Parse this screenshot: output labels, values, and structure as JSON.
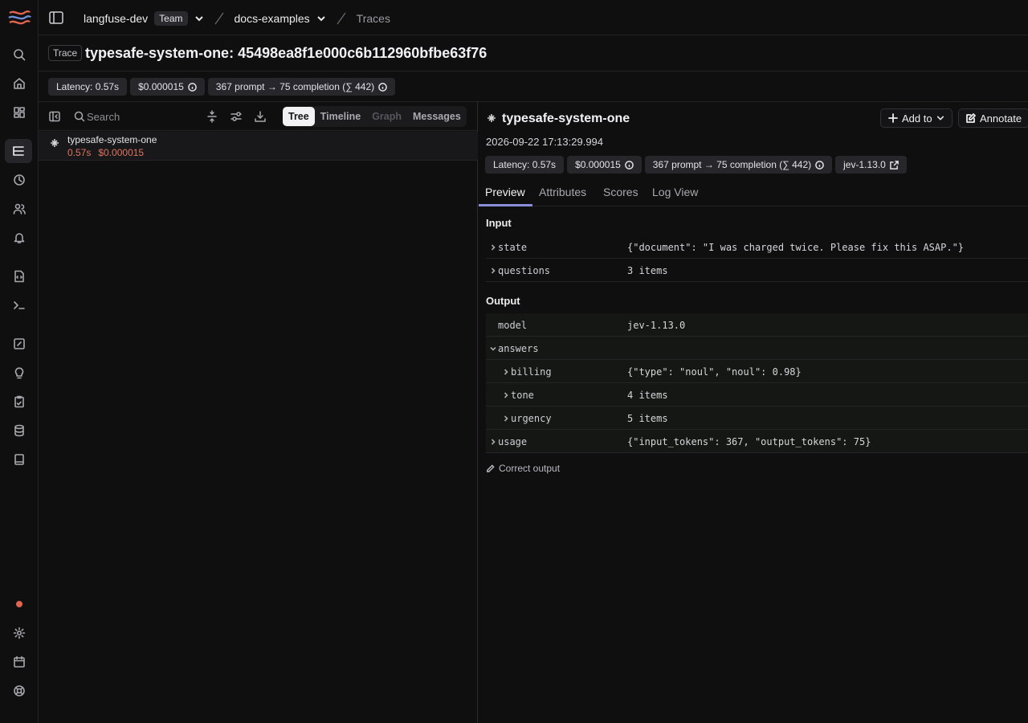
{
  "header": {
    "org": "langfuse-dev",
    "org_badge": "Team",
    "project": "docs-examples",
    "section": "Traces"
  },
  "trace": {
    "tag": "Trace",
    "title": "typesafe-system-one: 45498ea8f1e000c6b112960bfbe63f76",
    "badges": {
      "latency": "Latency: 0.57s",
      "cost": "$0.000015",
      "tokens": "367 prompt → 75 completion (∑ 442)"
    }
  },
  "left": {
    "search_placeholder": "Search",
    "view_tabs": [
      "Tree",
      "Timeline",
      "Graph",
      "Messages"
    ],
    "tree": [
      {
        "name": "typesafe-system-one",
        "latency": "0.57s",
        "cost": "$0.000015"
      }
    ]
  },
  "observation": {
    "name": "typesafe-system-one",
    "timestamp": "2026-09-22 17:13:29.994",
    "badges": {
      "latency": "Latency: 0.57s",
      "cost": "$0.000015",
      "tokens": "367 prompt → 75 completion (∑ 442)",
      "version": "jev-1.13.0"
    },
    "actions": {
      "add_to": "Add to",
      "annotate": "Annotate"
    },
    "tabs": [
      "Preview",
      "Attributes",
      "Scores",
      "Log View"
    ],
    "input_heading": "Input",
    "input": [
      {
        "key": "state",
        "value": "{\"document\": \"I was charged twice. Please fix this ASAP.\"}"
      },
      {
        "key": "questions",
        "value": "3 items"
      }
    ],
    "output_heading": "Output",
    "output": {
      "model_key": "model",
      "model_value": "jev-1.13.0",
      "answers_key": "answers",
      "billing_key": "billing",
      "billing_value": "{\"type\": \"noul\", \"noul\": 0.98}",
      "tone_key": "tone",
      "tone_value": "4 items",
      "urgency_key": "urgency",
      "urgency_value": "5 items",
      "usage_key": "usage",
      "usage_value": "{\"input_tokens\": 367, \"output_tokens\": 75}"
    },
    "correct_output": "Correct output"
  },
  "colors": {
    "accent": "#8a8dd8",
    "cost_text": "#e0735f",
    "status_dot": "#e0654f"
  }
}
